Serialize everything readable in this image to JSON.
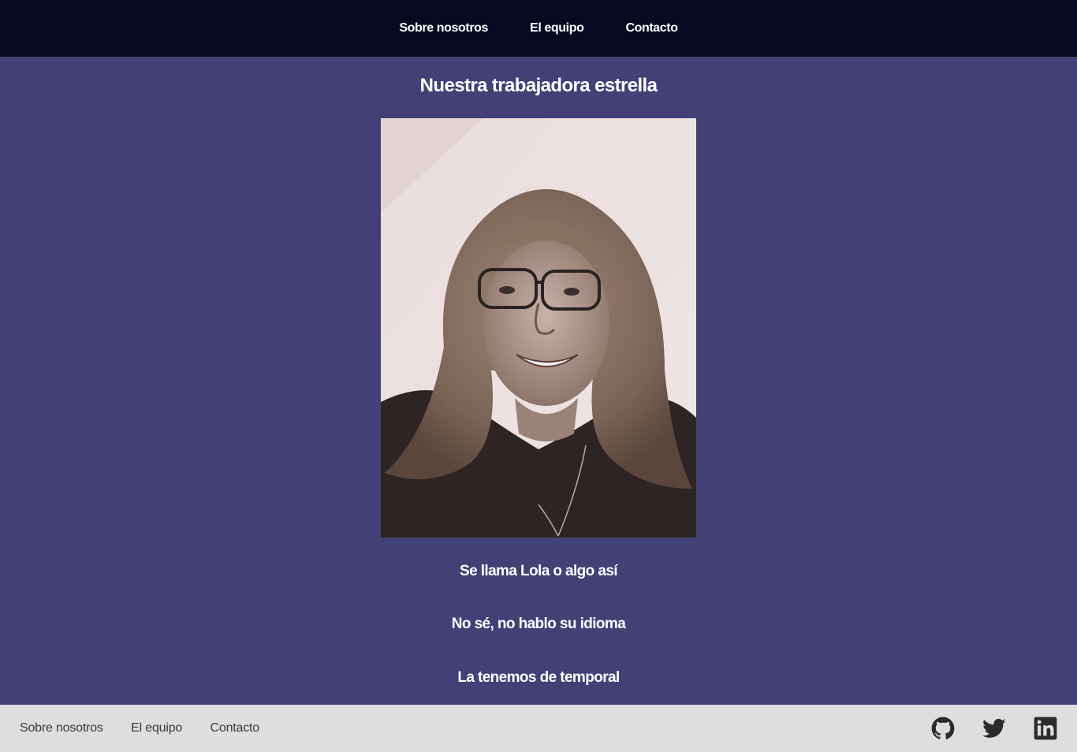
{
  "nav": {
    "items": [
      "Sobre nosotros",
      "El equipo",
      "Contacto"
    ]
  },
  "main": {
    "title": "Nuestra trabajadora estrella",
    "captions": [
      "Se llama Lola o algo así",
      "No sé, no hablo su idioma",
      "La tenemos de temporal"
    ]
  },
  "footer": {
    "links": [
      "Sobre nosotros",
      "El equipo",
      "Contacto"
    ],
    "social_icons": [
      "github-icon",
      "twitter-icon",
      "linkedin-icon"
    ]
  },
  "colors": {
    "nav_bg": "#080a22",
    "page_bg": "#434076",
    "footer_bg": "#dededf",
    "footer_text": "#3a3a3a"
  }
}
